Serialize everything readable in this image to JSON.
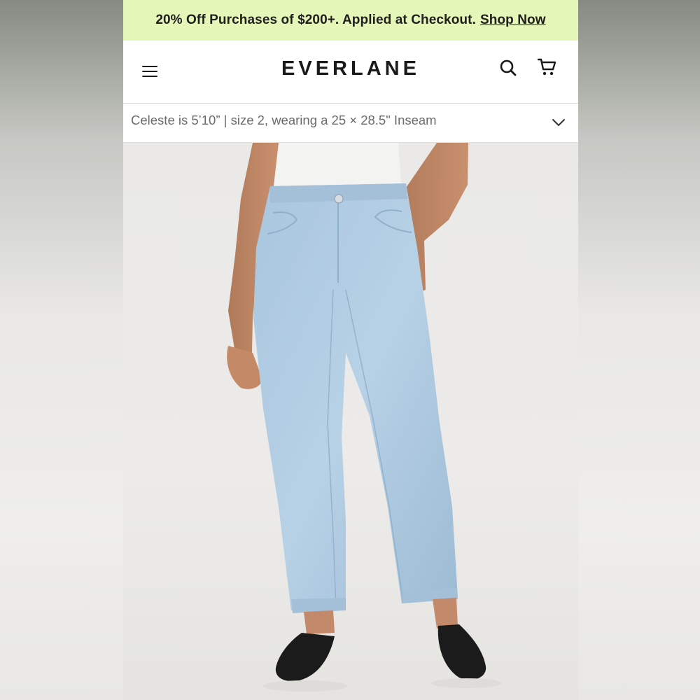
{
  "promo_banner": {
    "text": "20% Off Purchases of $200+. Applied at Checkout.",
    "link_label": "Shop Now",
    "background": "#e4f6b8"
  },
  "header": {
    "brand": "EVERLANE",
    "menu_icon": "hamburger-menu-icon",
    "search_icon": "search-icon",
    "cart_icon": "cart-icon"
  },
  "model_info": {
    "text": "Celeste is 5’10” | size 2, wearing a 25 × 28.5\" Inseam",
    "toggle_icon": "chevron-down-icon"
  },
  "product_image": {
    "subject": "light-wash straight-leg jeans on model with black loafers"
  }
}
